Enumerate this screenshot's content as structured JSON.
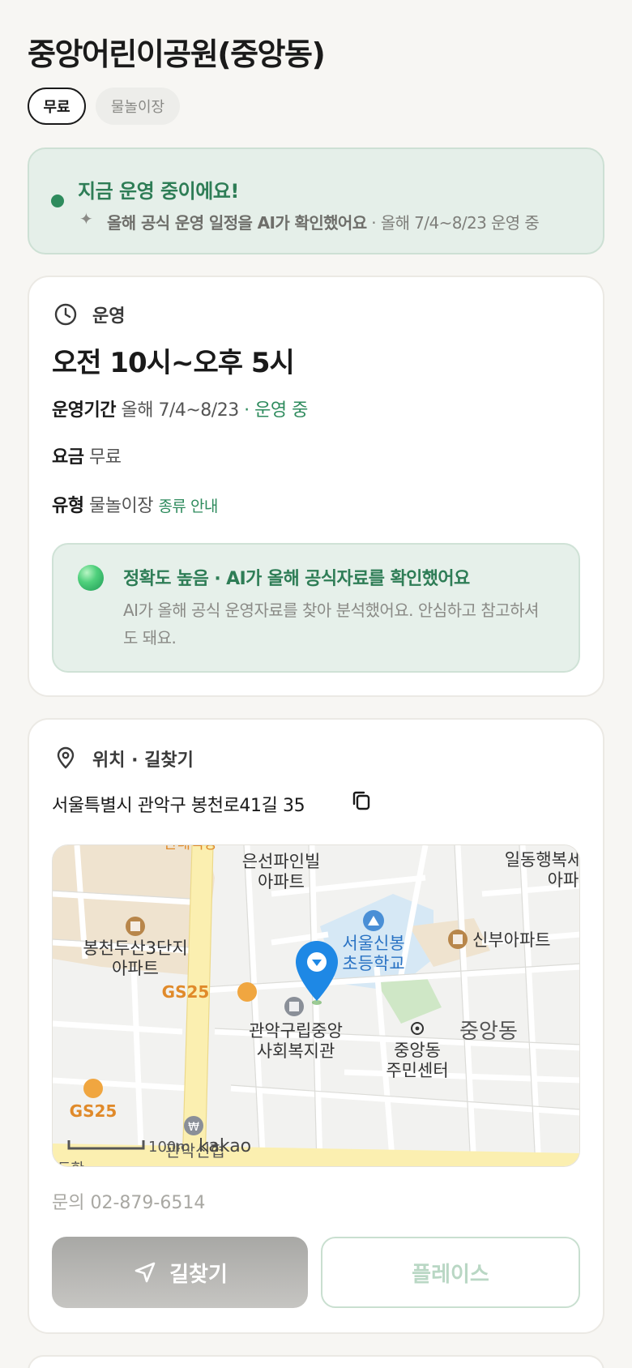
{
  "header": {
    "title": "중앙어린이공원(중앙동)",
    "chips": [
      "무료",
      "물놀이장"
    ]
  },
  "status": {
    "title": "지금 운영 중이에요!",
    "sub_bold": "올해 공식 운영 일정을 AI가 확인했어요",
    "sub_rest": " · 올해 7/4~8/23 운영 중"
  },
  "hours": {
    "section_label": "운영",
    "main": "오전 10시~오후 5시",
    "period_key": "운영기간",
    "period_value": "올해 7/4~8/23",
    "period_status": " · 운영 중",
    "fee_key": "요금",
    "fee_value": "무료",
    "type_key": "유형",
    "type_value": "물놀이장",
    "type_link": "종류 안내"
  },
  "accuracy": {
    "title": "정확도 높음 · AI가 올해 공식자료를 확인했어요",
    "desc": "AI가 올해 공식 운영자료를 찾아 분석했어요. 안심하고 참고하셔도 돼요."
  },
  "location": {
    "section_label": "위치 · 길찾기",
    "address": "서울특별시 관악구 봉천로41길 35",
    "contact": "문의 02-879-6514"
  },
  "map": {
    "labels": {
      "apt1_l1": "은선파인빌",
      "apt1_l2": "아파트",
      "apt2_l1": "일동행복세",
      "apt2_l2": "아파",
      "apt3_l1": "봉천두산3단지",
      "apt3_l2": "아파트",
      "school_l1": "서울신봉",
      "school_l2": "초등학교",
      "apt4": "신부아파트",
      "gs1": "GS25",
      "welfare_l1": "관악구립중앙",
      "welfare_l2": "사회복지관",
      "center_l1": "중앙동",
      "center_l2": "주민센터",
      "dong": "중앙동",
      "gs2": "GS25",
      "bank": "관악신협",
      "scale": "100m",
      "brand": "kakao",
      "top_cut": "관태식당",
      "bottom_cut": "도한"
    },
    "colors": {
      "road": "#ffffff",
      "major_road": "#fbefb0",
      "building": "#efe3cf",
      "park": "#cfe7c6",
      "water": "#d6e8f5",
      "pin": "#1e88e5"
    }
  },
  "buttons": {
    "directions": "길찾기",
    "place": "플레이스"
  }
}
